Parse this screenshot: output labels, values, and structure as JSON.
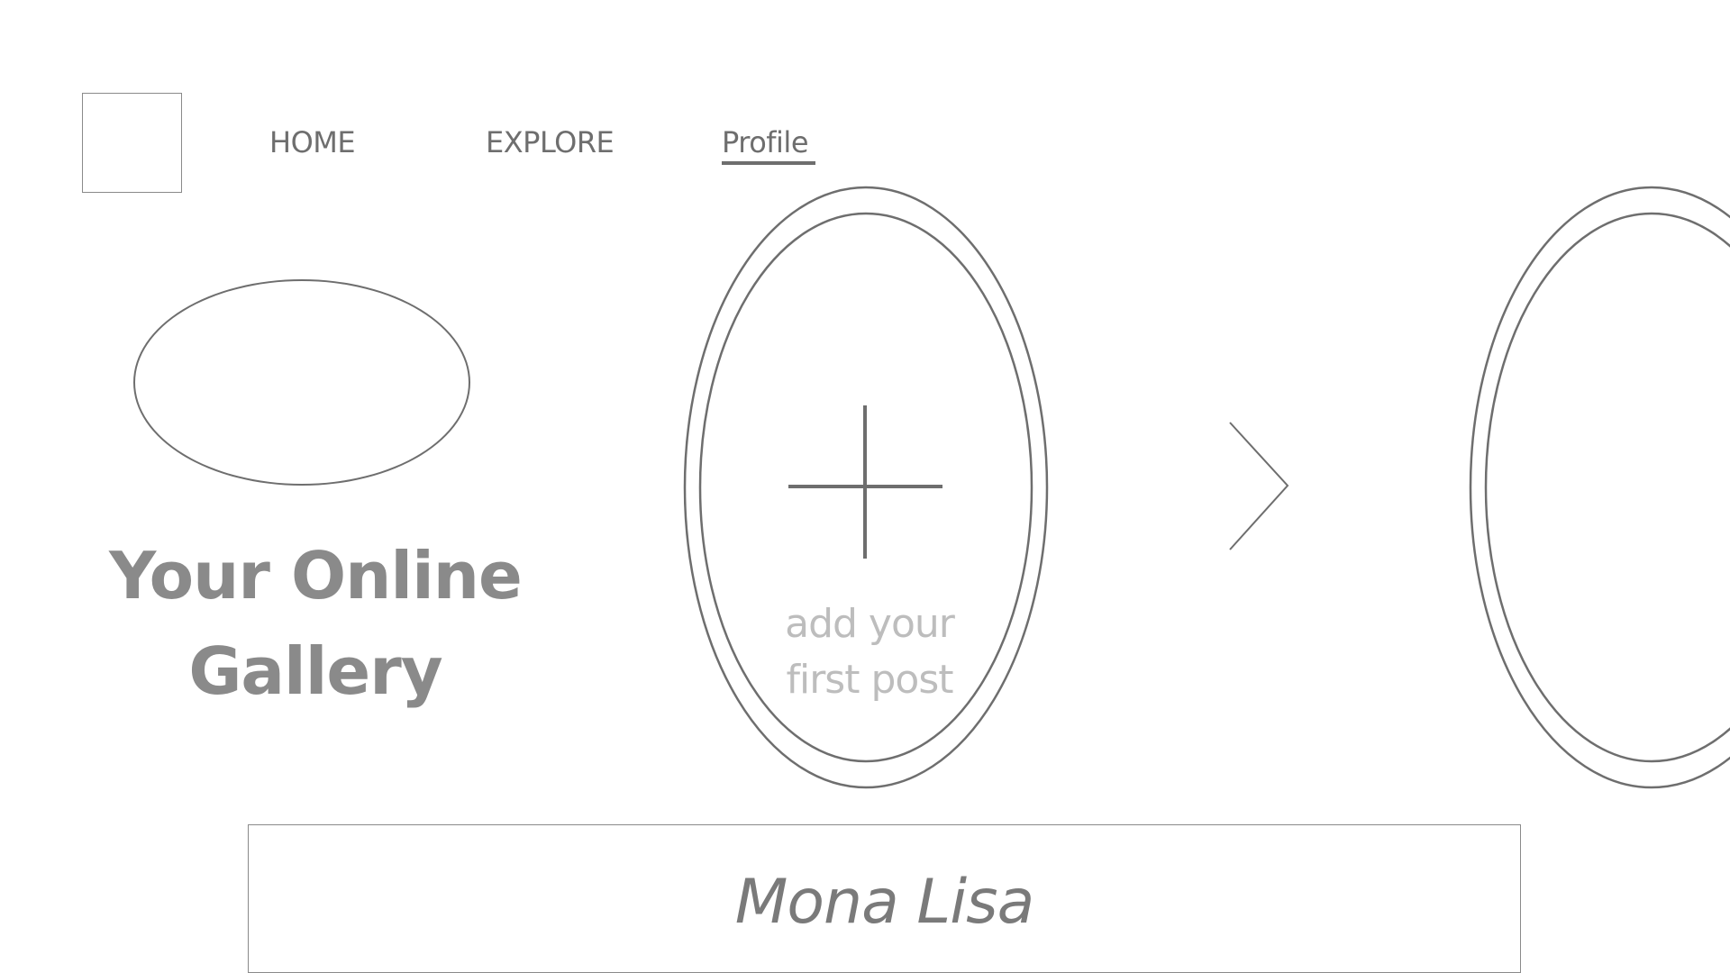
{
  "nav": {
    "items": [
      {
        "label": "HOME"
      },
      {
        "label": "EXPLORE"
      },
      {
        "label": "Profile",
        "active": true
      }
    ]
  },
  "hero": {
    "title_line1": "Your Online",
    "title_line2": "Gallery"
  },
  "gallery": {
    "add_post_line1": "add your",
    "add_post_line2": "first post",
    "add_icon": "plus-icon",
    "next_icon": "chevron-right-icon"
  },
  "caption": {
    "text": "Mona Lisa"
  },
  "colors": {
    "stroke": "#6e6e6e",
    "hero_text": "#8a8a8a",
    "placeholder_text": "#bdbdbd"
  }
}
